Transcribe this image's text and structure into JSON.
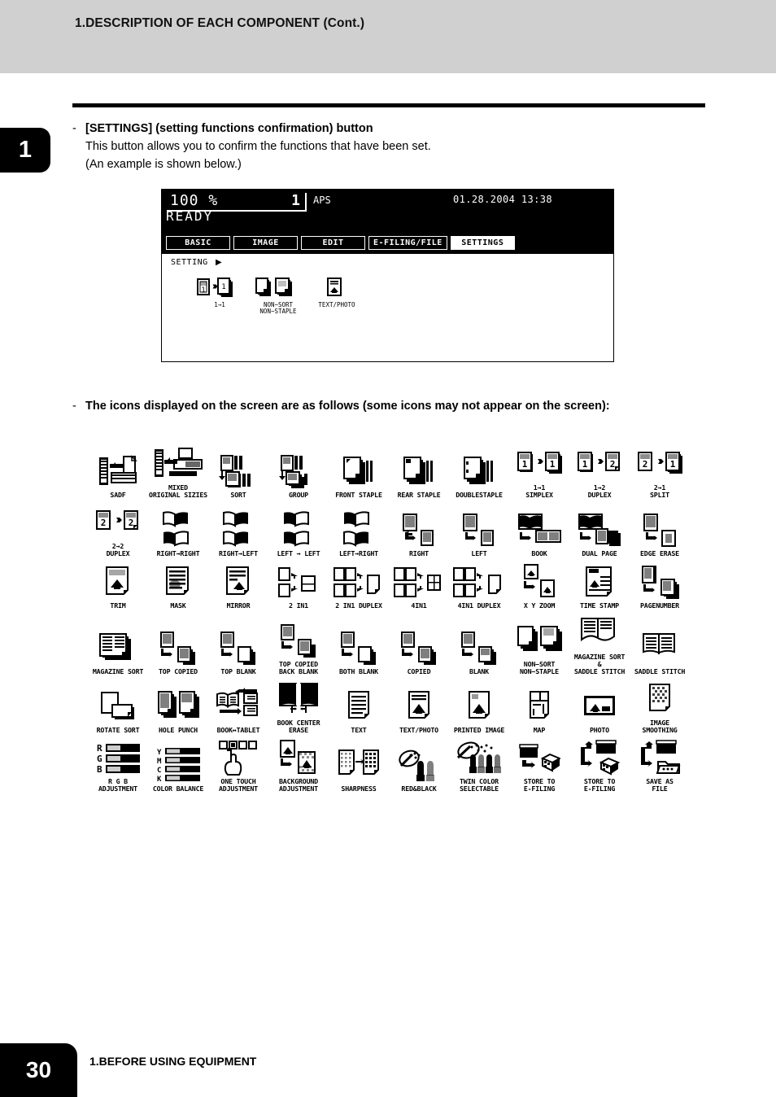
{
  "header": {
    "title": "1.DESCRIPTION OF EACH COMPONENT (Cont.)"
  },
  "chapter_tab": "1",
  "bullets": [
    {
      "dash": "-",
      "heading": "[SETTINGS] (setting functions confirmation) button",
      "lines": [
        "This button allows you to confirm the functions that have been set.",
        "(An example is shown below.)"
      ]
    },
    {
      "dash": "-",
      "heading": "The icons displayed on the screen are as follows (some icons may not appear on the screen):",
      "lines": []
    }
  ],
  "lcd": {
    "ratio": "100  %",
    "copies": "1",
    "paper_mode": "APS",
    "datetime": "01.28.2004 13:38",
    "status": "READY",
    "tabs": [
      {
        "label": "BASIC",
        "selected": false
      },
      {
        "label": "IMAGE",
        "selected": false
      },
      {
        "label": "EDIT",
        "selected": false
      },
      {
        "label": "E-FILING/FILE",
        "selected": false
      },
      {
        "label": "SETTINGS",
        "selected": true
      }
    ],
    "setting_label": "SETTING",
    "setting_arrow": "▶",
    "icons": [
      {
        "name": "one-to-one-icon",
        "caption": "1→1"
      },
      {
        "name": "non-sort-non-staple-icon",
        "caption": "NON−SORT\nNON−STAPLE"
      },
      {
        "name": "text-photo-icon",
        "caption": "TEXT/PHOTO"
      }
    ]
  },
  "glossary": {
    "rows": [
      [
        {
          "name": "sadf-icon",
          "caption": "SADF"
        },
        {
          "name": "mixed-original-sizes-icon",
          "caption": "MIXED\nORIGINAL SIZIES"
        },
        {
          "name": "sort-icon",
          "caption": "SORT"
        },
        {
          "name": "group-icon",
          "caption": "GROUP"
        },
        {
          "name": "front-staple-icon",
          "caption": "FRONT STAPLE"
        },
        {
          "name": "rear-staple-icon",
          "caption": "REAR STAPLE"
        },
        {
          "name": "double-staple-icon",
          "caption": "DOUBLESTAPLE"
        },
        {
          "name": "one-to-one-simplex-icon",
          "caption": "1→1\nSIMPLEX"
        },
        {
          "name": "one-to-two-duplex-icon",
          "caption": "1→2\nDUPLEX"
        },
        {
          "name": "two-to-one-split-icon",
          "caption": "2→1\nSPLIT"
        }
      ],
      [
        {
          "name": "two-to-two-duplex-icon",
          "caption": "2→2\nDUPLEX"
        },
        {
          "name": "right-to-right-icon",
          "caption": "RIGHT→RIGHT"
        },
        {
          "name": "right-to-left-icon",
          "caption": "RIGHT→LEFT"
        },
        {
          "name": "left-to-left-icon",
          "caption": "LEFT → LEFT"
        },
        {
          "name": "left-to-right-icon",
          "caption": "LEFT→RIGHT"
        },
        {
          "name": "right-icon",
          "caption": "RIGHT"
        },
        {
          "name": "left-icon",
          "caption": "LEFT"
        },
        {
          "name": "book-icon",
          "caption": "BOOK"
        },
        {
          "name": "dual-page-icon",
          "caption": "DUAL PAGE"
        },
        {
          "name": "edge-erase-icon",
          "caption": "EDGE ERASE"
        }
      ],
      [
        {
          "name": "trim-icon",
          "caption": "TRIM"
        },
        {
          "name": "mask-icon",
          "caption": "MASK"
        },
        {
          "name": "mirror-icon",
          "caption": "MIRROR"
        },
        {
          "name": "two-in-one-icon",
          "caption": "2 IN1"
        },
        {
          "name": "two-in-one-duplex-icon",
          "caption": "2 IN1 DUPLEX"
        },
        {
          "name": "four-in-one-icon",
          "caption": "4IN1"
        },
        {
          "name": "four-in-one-duplex-icon",
          "caption": "4IN1 DUPLEX"
        },
        {
          "name": "xy-zoom-icon",
          "caption": "X Y ZOOM"
        },
        {
          "name": "time-stamp-icon",
          "caption": "TIME STAMP"
        },
        {
          "name": "page-number-icon",
          "caption": "PAGENUMBER"
        }
      ],
      [
        {
          "name": "magazine-sort-icon",
          "caption": "MAGAZINE SORT"
        },
        {
          "name": "top-copied-icon",
          "caption": "TOP COPIED"
        },
        {
          "name": "top-blank-icon",
          "caption": "TOP BLANK"
        },
        {
          "name": "top-copied-back-blank-icon",
          "caption": "TOP COPIED\nBACK BLANK"
        },
        {
          "name": "both-blank-icon",
          "caption": "BOTH BLANK"
        },
        {
          "name": "copied-icon",
          "caption": "COPIED"
        },
        {
          "name": "blank-icon",
          "caption": "BLANK"
        },
        {
          "name": "non-sort-non-staple-icon",
          "caption": "NON−SORT\nNON−STAPLE"
        },
        {
          "name": "magazine-sort-and-saddle-stitch-icon",
          "caption": "MAGAZINE SORT\n&\nSADDLE STITCH"
        },
        {
          "name": "saddle-stitch-icon",
          "caption": "SADDLE STITCH"
        }
      ],
      [
        {
          "name": "rotate-sort-icon",
          "caption": "ROTATE SORT"
        },
        {
          "name": "hole-punch-icon",
          "caption": "HOLE PUNCH"
        },
        {
          "name": "book-tablet-icon",
          "caption": "BOOK↔TABLET"
        },
        {
          "name": "book-center-erase-icon",
          "caption": "BOOK CENTER\nERASE"
        },
        {
          "name": "text-icon",
          "caption": "TEXT"
        },
        {
          "name": "text-photo-icon",
          "caption": "TEXT/PHOTO"
        },
        {
          "name": "printed-image-icon",
          "caption": "PRINTED IMAGE"
        },
        {
          "name": "map-icon",
          "caption": "MAP"
        },
        {
          "name": "photo-icon",
          "caption": "PHOTO"
        },
        {
          "name": "image-smoothing-icon",
          "caption": "IMAGE\nSMOOTHING"
        }
      ],
      [
        {
          "name": "rgb-adjustment-icon",
          "caption": "R G B\nADJUSTMENT"
        },
        {
          "name": "color-balance-icon",
          "caption": "COLOR BALANCE"
        },
        {
          "name": "one-touch-adjustment-icon",
          "caption": "ONE TOUCH\nADJUSTMENT"
        },
        {
          "name": "background-adjustment-icon",
          "caption": "BACKGROUND\nADJUSTMENT"
        },
        {
          "name": "sharpness-icon",
          "caption": "SHARPNESS"
        },
        {
          "name": "red-and-black-icon",
          "caption": "RED&BLACK"
        },
        {
          "name": "twin-color-selectable-icon",
          "caption": "TWIN COLOR\nSELECTABLE"
        },
        {
          "name": "store-to-e-filing-icon",
          "caption": "STORE TO\nE-FILING"
        },
        {
          "name": "store-to-e-filing-copy-icon",
          "caption": "STORE TO\nE-FILING"
        },
        {
          "name": "save-as-file-icon",
          "caption": "SAVE AS\nFILE"
        }
      ]
    ]
  },
  "rgb_rows": [
    "R",
    "G",
    "B"
  ],
  "cmyk_rows": [
    "Y",
    "M",
    "C",
    "K"
  ],
  "footer": {
    "page_number": "30",
    "chapter": "1.BEFORE USING EQUIPMENT"
  }
}
